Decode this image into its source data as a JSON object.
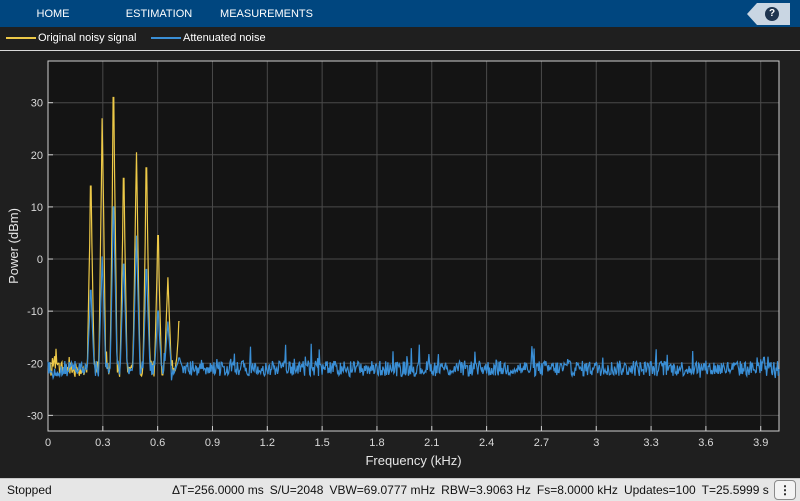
{
  "toolstrip": {
    "tabs": [
      "HOME",
      "ESTIMATION",
      "MEASUREMENTS"
    ],
    "help_icon": "question-mark-icon"
  },
  "legend": {
    "items": [
      {
        "label": "Original noisy signal",
        "color": "#edc948"
      },
      {
        "label": "Attenuated noise",
        "color": "#3a8fd6"
      }
    ]
  },
  "chart_data": {
    "type": "line",
    "xlabel": "Frequency (kHz)",
    "ylabel": "Power (dBm)",
    "xlim": [
      0,
      4.0
    ],
    "ylim": [
      -33,
      38
    ],
    "xticks": [
      0,
      0.3,
      0.6,
      0.9,
      1.2,
      1.5,
      1.8,
      2.1,
      2.4,
      2.7,
      3.0,
      3.3,
      3.6,
      3.9
    ],
    "xtick_labels": [
      "0",
      "0.3",
      "0.6",
      "0.9",
      "1.2",
      "1.5",
      "1.8",
      "2.1",
      "2.4",
      "2.7",
      "3",
      "3.3",
      "3.6",
      "3.9"
    ],
    "yticks": [
      -30,
      -20,
      -10,
      0,
      10,
      20,
      30
    ],
    "ytick_labels": [
      "-30",
      "-20",
      "-10",
      "0",
      "10",
      "20",
      "30"
    ],
    "grid": true,
    "noise_floor": -21,
    "series": [
      {
        "name": "Original noisy signal",
        "color": "#edc948",
        "x_range": [
          0,
          0.72
        ],
        "peaks": [
          {
            "x": 0.234,
            "y": 14
          },
          {
            "x": 0.297,
            "y": 27
          },
          {
            "x": 0.359,
            "y": 31
          },
          {
            "x": 0.414,
            "y": 15.5
          },
          {
            "x": 0.484,
            "y": 20.5
          },
          {
            "x": 0.539,
            "y": 17.5
          },
          {
            "x": 0.602,
            "y": 4.5
          },
          {
            "x": 0.656,
            "y": -3.5
          },
          {
            "x": 0.719,
            "y": -12
          }
        ]
      },
      {
        "name": "Attenuated noise",
        "color": "#3a8fd6",
        "x_range": [
          0,
          4.0
        ],
        "peaks": [
          {
            "x": 0.234,
            "y": -6
          },
          {
            "x": 0.297,
            "y": 0.5
          },
          {
            "x": 0.359,
            "y": 10
          },
          {
            "x": 0.414,
            "y": -1
          },
          {
            "x": 0.484,
            "y": 4.5
          },
          {
            "x": 0.539,
            "y": -2
          },
          {
            "x": 0.602,
            "y": -10
          },
          {
            "x": 0.656,
            "y": -12
          },
          {
            "x": 0.719,
            "y": -19
          }
        ]
      }
    ]
  },
  "status": {
    "state": "Stopped",
    "items": [
      "ΔT=256.0000 ms",
      "S/U=2048",
      "VBW=69.0777 mHz",
      "RBW=3.9063 Hz",
      "Fs=8.0000 kHz",
      "Updates=100",
      "T=25.5999 s"
    ],
    "menu_icon": "vertical-ellipsis-icon"
  }
}
